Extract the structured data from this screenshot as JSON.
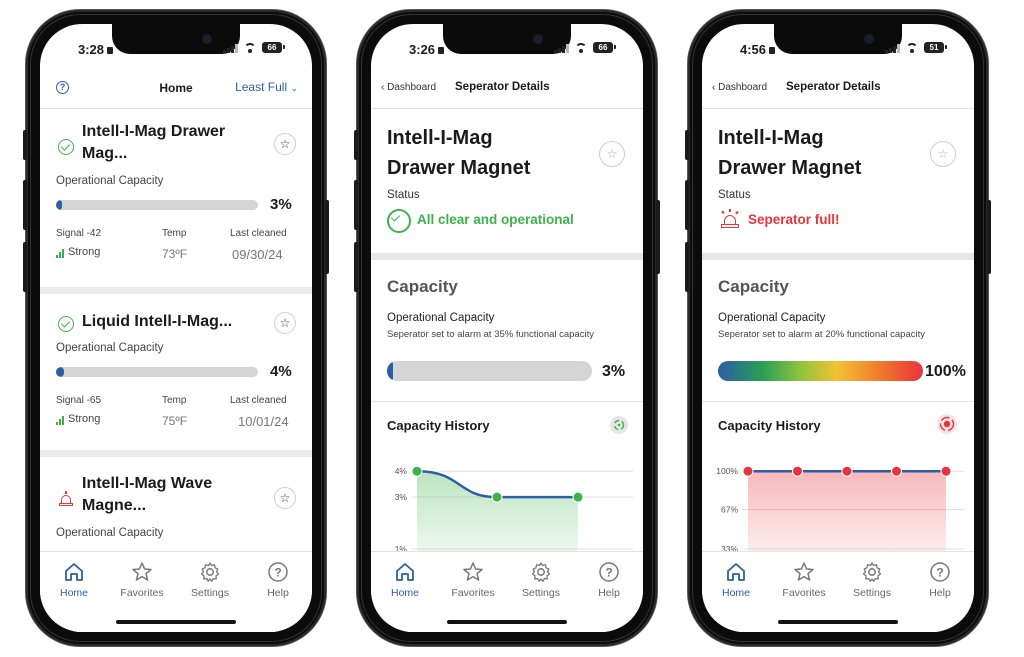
{
  "tabbar": [
    {
      "label": "Home",
      "icon": "home-icon"
    },
    {
      "label": "Favorites",
      "icon": "star-icon"
    },
    {
      "label": "Settings",
      "icon": "gear-icon"
    },
    {
      "label": "Help",
      "icon": "help-icon"
    }
  ],
  "phone1": {
    "time": "3:28",
    "battery": "66",
    "header": {
      "title": "Home",
      "sort": "Least Full"
    },
    "cards": [
      {
        "title_line1": "Intell-I-Mag Drawer",
        "title_line2": "Mag...",
        "capacity_label": "Operational Capacity",
        "capacity_pct": "3%",
        "capacity_value": 0.03,
        "signal_label": "Signal -42",
        "signal_value": "Strong",
        "temp_label": "Temp",
        "temp_value": "73ºF",
        "cleaned_label": "Last cleaned",
        "cleaned_value": "09/30/24",
        "status": "ok"
      },
      {
        "title_line1": "Liquid Intell-I-Mag...",
        "capacity_label": "Operational Capacity",
        "capacity_pct": "4%",
        "capacity_value": 0.04,
        "signal_label": "Signal -65",
        "signal_value": "Strong",
        "temp_label": "Temp",
        "temp_value": "75ºF",
        "cleaned_label": "Last cleaned",
        "cleaned_value": "10/01/24",
        "status": "ok"
      },
      {
        "title_line1": "Intell-I-Mag Wave",
        "title_line2": "Magne...",
        "capacity_label": "Operational Capacity",
        "status": "alarm"
      }
    ]
  },
  "phone2": {
    "time": "3:26",
    "battery": "66",
    "header": {
      "back": "Dashboard",
      "title": "Seperator Details"
    },
    "title_line1": "Intell-I-Mag",
    "title_line2": "Drawer Magnet",
    "status_label": "Status",
    "status_msg": "All clear and operational",
    "capacity_section": "Capacity",
    "op_capacity": "Operational Capacity",
    "alarm_note": "Seperator set to alarm at 35% functional capacity",
    "capacity_pct": "3%",
    "capacity_value": 0.03,
    "history_title": "Capacity History",
    "chart_data": {
      "type": "line",
      "x": [
        0,
        1,
        2
      ],
      "values": [
        4,
        3,
        3
      ],
      "yticks": [
        "4%",
        "3%",
        "1%"
      ],
      "ylim": [
        1,
        4
      ],
      "color": "#2c5ea8",
      "fill": "#3db24a"
    }
  },
  "phone3": {
    "time": "4:56",
    "battery": "51",
    "header": {
      "back": "Dashboard",
      "title": "Seperator Details"
    },
    "title_line1": "Intell-I-Mag",
    "title_line2": "Drawer Magnet",
    "status_label": "Status",
    "status_msg": "Seperator full!",
    "capacity_section": "Capacity",
    "op_capacity": "Operational Capacity",
    "alarm_note": "Seperator set to alarm at 20% functional capacity",
    "capacity_pct": "100%",
    "capacity_value": 1.0,
    "history_title": "Capacity History",
    "chart_data": {
      "type": "line",
      "x": [
        0,
        1,
        2,
        3,
        4
      ],
      "values": [
        100,
        100,
        100,
        100,
        100
      ],
      "yticks": [
        "100%",
        "67%",
        "33%"
      ],
      "ylim": [
        33,
        100
      ],
      "color": "#2c5ea8",
      "fill": "#e9333a"
    }
  },
  "colors": {
    "accent": "#2c5ea8",
    "ok": "#3db24a",
    "alarm": "#e9333a"
  }
}
